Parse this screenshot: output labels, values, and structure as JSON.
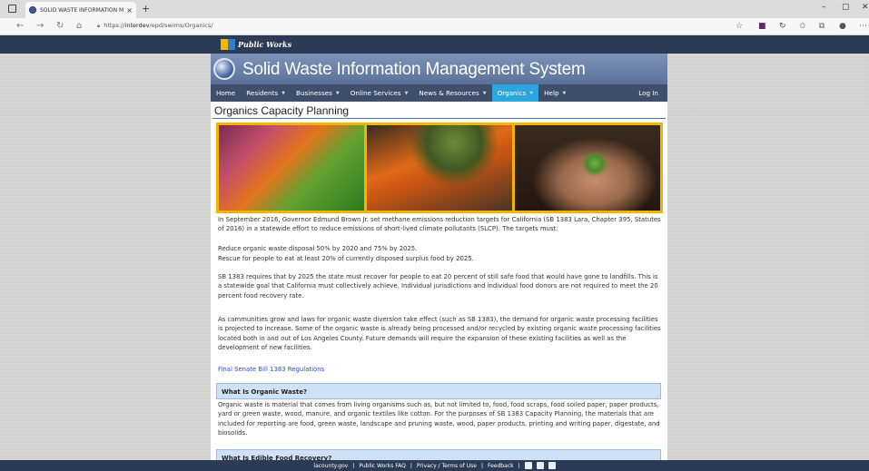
{
  "browser": {
    "tab_title": "SOLID WASTE INFORMATION M",
    "tab_close": "×",
    "new_tab": "+",
    "url_prefix": "https://",
    "url_host": "interdev",
    "url_path": "/epd/swims/Organics/",
    "win_min": "–",
    "win_max": "▢",
    "win_close": "✕"
  },
  "site": {
    "logo_text": "Public Works",
    "title": "Solid Waste Information Management System"
  },
  "menu": {
    "items": [
      {
        "label": "Home",
        "dropdown": false
      },
      {
        "label": "Residents",
        "dropdown": true
      },
      {
        "label": "Businesses",
        "dropdown": true
      },
      {
        "label": "Online Services",
        "dropdown": true
      },
      {
        "label": "News & Resources",
        "dropdown": true
      },
      {
        "label": "Organics",
        "dropdown": true
      },
      {
        "label": "Help",
        "dropdown": true
      }
    ],
    "active": "Organics",
    "login": "Log In"
  },
  "page": {
    "title": "Organics Capacity Planning",
    "p1": "In September 2016, Governor Edmund Brown Jr. set methane emissions reduction targets for California (SB 1383 Lara, Chapter 395, Statutes of 2016) in a statewide effort to reduce emissions of short-lived climate pollutants (SLCP). The targets must:",
    "target1": "Reduce organic waste disposal 50% by 2020 and 75% by 2025.",
    "target2": "Rescue for people to eat at least 20% of currently disposed surplus food by 2025.",
    "p2": "SB 1383 requires that by 2025 the state must recover for people to eat 20 percent of still safe food that would have gone to landfills. This is a statewide goal that California must collectively achieve. Individual jurisdictions and individual food donors are not required to meet the 20 percent food recovery rate.",
    "p3": "As communities grow and laws for organic waste diversion take effect (such as SB 1383), the demand for organic waste processing facilities is projected to increase. Some of the organic waste is already being processed and/or recycled by existing organic waste processing facilities located both in and out of Los Angeles County. Future demands will require the expansion of these existing facilities as well as the development of new facilities.",
    "link": "Final Senate Bill 1383 Regulations",
    "section1_title": "What Is Organic Waste?",
    "section1_text": "Organic waste is material that comes from living organisms such as, but not limited to, food, food scraps, food soiled paper, paper products, yard or green waste, wood, manure, and organic textiles like cotton. For the purposes of SB 1383 Capacity Planning, the materials that are included for reporting are food, green waste, landscape and pruning waste, wood, paper products, printing and writing paper, digestate, and biosolids.",
    "section2_title": "What Is Edible Food Recovery?"
  },
  "footer": {
    "link1": "lacounty.gov",
    "link2": "Public Works FAQ",
    "link3": "Privacy / Terms of Use",
    "link4": "Feedback",
    "sep": "|"
  }
}
